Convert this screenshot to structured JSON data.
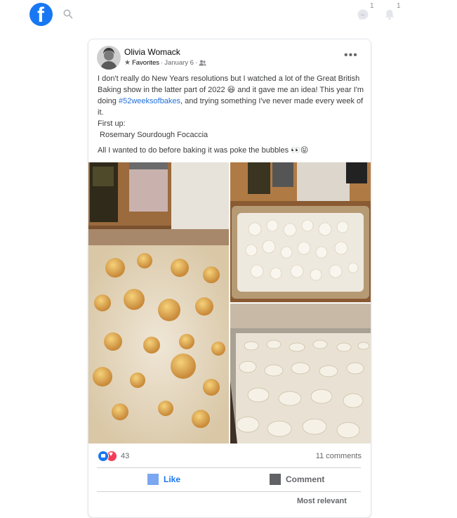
{
  "topbar": {
    "logo_letter": "f",
    "messenger_badge": "1",
    "notifications_badge": "1"
  },
  "post": {
    "author": "Olivia Womack",
    "audience_list": "Favorites",
    "date": "January 6",
    "separator": "·",
    "more_label": "•••",
    "text": {
      "line1_pre": "I don't really do New Years resolutions but I watched a lot of the Great British Baking show in the latter part of 2022 ",
      "emoji1": "😆",
      "line1_mid": " and it gave me an idea! This year I'm doing ",
      "hashtag": "#52weeksofbakes",
      "line1_post": ", and trying something I've never made every week of it.",
      "first_up": "First up:",
      "recipe": " Rosemary Sourdough Focaccia",
      "line2": "All I wanted to do before baking it was poke the bubbles ",
      "emoji2": "👀😝"
    },
    "reactions": {
      "count": "43",
      "types": [
        "like",
        "love"
      ]
    },
    "comments_count": "11 comments",
    "actions": {
      "like": "Like",
      "comment": "Comment"
    },
    "sort_label": "Most relevant"
  },
  "icons": {
    "brand": "facebook-logo",
    "search": "search-icon",
    "messenger": "messenger-icon",
    "notifications": "bell-icon"
  },
  "colors": {
    "brand": "#1877f2",
    "link": "#216fdb",
    "love": "#f33e58"
  }
}
